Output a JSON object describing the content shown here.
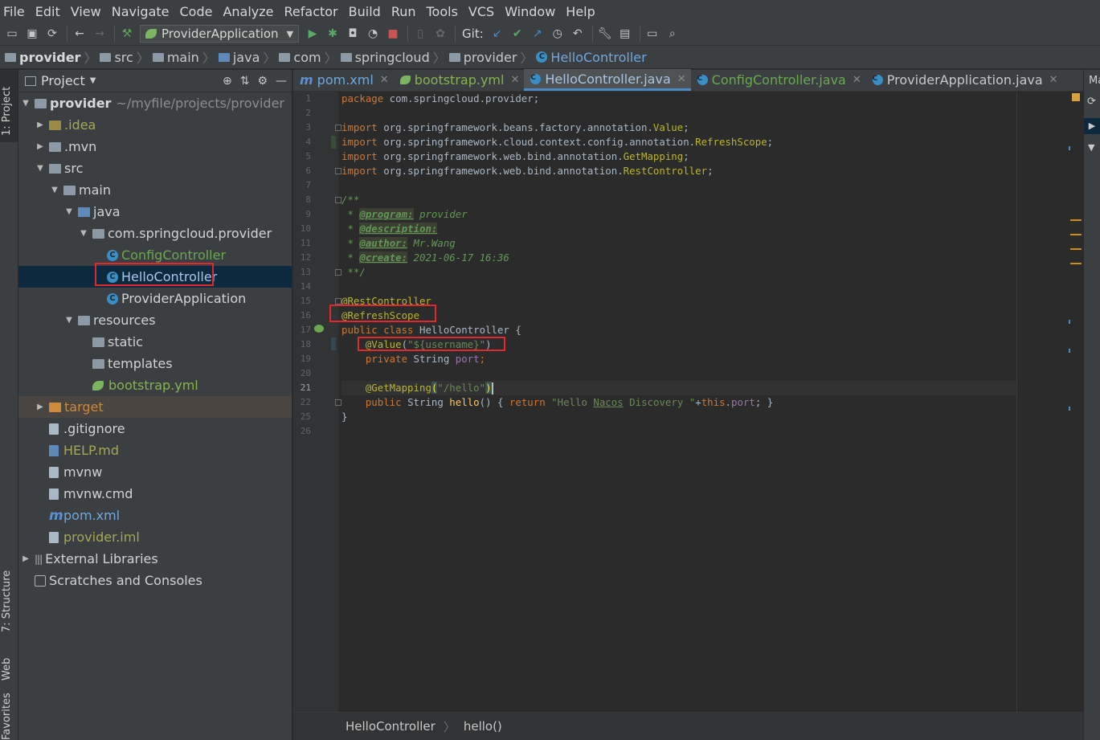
{
  "menu": [
    "File",
    "Edit",
    "View",
    "Navigate",
    "Code",
    "Analyze",
    "Refactor",
    "Build",
    "Run",
    "Tools",
    "VCS",
    "Window",
    "Help"
  ],
  "toolbar": {
    "run_config": "ProviderApplication",
    "git_label": "Git:"
  },
  "breadcrumb": [
    "provider",
    "src",
    "main",
    "java",
    "com",
    "springcloud",
    "provider",
    "HelloController"
  ],
  "project_panel": {
    "title": "Project",
    "root_name": "provider",
    "root_path": "~/myfile/projects/provider",
    "items": [
      {
        "label": ".idea"
      },
      {
        "label": ".mvn"
      },
      {
        "label": "src"
      },
      {
        "label": "main"
      },
      {
        "label": "java"
      },
      {
        "label": "com.springcloud.provider"
      },
      {
        "label": "ConfigController"
      },
      {
        "label": "HelloController"
      },
      {
        "label": "ProviderApplication"
      },
      {
        "label": "resources"
      },
      {
        "label": "static"
      },
      {
        "label": "templates"
      },
      {
        "label": "bootstrap.yml"
      },
      {
        "label": "target"
      },
      {
        "label": ".gitignore"
      },
      {
        "label": "HELP.md"
      },
      {
        "label": "mvnw"
      },
      {
        "label": "mvnw.cmd"
      },
      {
        "label": "pom.xml"
      },
      {
        "label": "provider.iml"
      },
      {
        "label": "External Libraries"
      },
      {
        "label": "Scratches and Consoles"
      }
    ]
  },
  "side_tabs": {
    "project": "1: Project",
    "structure": "7: Structure",
    "web": "Web",
    "favorites": "Favorites",
    "right_top": "Ma"
  },
  "tabs": [
    {
      "label": "pom.xml"
    },
    {
      "label": "bootstrap.yml"
    },
    {
      "label": "HelloController.java"
    },
    {
      "label": "ConfigController.java"
    },
    {
      "label": "ProviderApplication.java"
    }
  ],
  "editor": {
    "line_numbers": [
      "1",
      "2",
      "3",
      "4",
      "5",
      "6",
      "7",
      "8",
      "9",
      "10",
      "11",
      "12",
      "13",
      "14",
      "15",
      "16",
      "17",
      "18",
      "19",
      "20",
      "21",
      "22",
      "25",
      "26"
    ],
    "code": {
      "l1_kw": "package",
      "l1_rest": " com.springcloud.provider;",
      "l3_kw": "import",
      "l3_pkg": " org.springframework.beans.factory.annotation.",
      "l3_cls": "Value",
      "l4_kw": "import",
      "l4_pkg": " org.springframework.cloud.context.config.annotation.",
      "l4_cls": "RefreshScope",
      "l5_kw": "import",
      "l5_pkg": " org.springframework.web.bind.annotation.",
      "l5_cls": "GetMapping",
      "l6_kw": "import",
      "l6_pkg": " org.springframework.web.bind.annotation.",
      "l6_cls": "RestController",
      "l8": "/**",
      "l9_star": " * ",
      "l9_tag": "@program:",
      "l9_val": " provider",
      "l10_star": " * ",
      "l10_tag": "@description:",
      "l11_star": " * ",
      "l11_tag": "@author:",
      "l11_val": " Mr.Wang",
      "l12_star": " * ",
      "l12_tag": "@create:",
      "l12_val": " 2021-06-17 16:36",
      "l13": " **/",
      "l15": "@RestController",
      "l16": "@RefreshScope",
      "l17_kw": "public class",
      "l17_rest": " HelloController {",
      "l18_an": "@Value",
      "l18_p1": "(",
      "l18_str": "\"${username}\"",
      "l18_p2": ")",
      "l19_kw": "private",
      "l19_type": " String ",
      "l19_fld": "port",
      "l19_end": ";",
      "l21_an": "@GetMapping",
      "l21_p1": "(",
      "l21_str": "\"/hello\"",
      "l21_p2": ")",
      "l22_kw": "public",
      "l22_type": " String ",
      "l22_fn": "hello",
      "l22_p": "() { ",
      "l22_ret": "return",
      "l22_str1": " \"Hello ",
      "l22_str2": "Nacos",
      "l22_str3": " Discovery \"",
      "l22_plus": "+",
      "l22_this": "this",
      "l22_dot": ".",
      "l22_fld": "port",
      "l22_end": "; }",
      "l25": "}"
    }
  },
  "editor_breadcrumb": [
    "HelloController",
    "hello()"
  ],
  "colors": {
    "accent": "#4a88c7",
    "highlight_box": "#e0282e",
    "keyword": "#cc7832",
    "annotation": "#bbb529",
    "string": "#6a8759"
  }
}
